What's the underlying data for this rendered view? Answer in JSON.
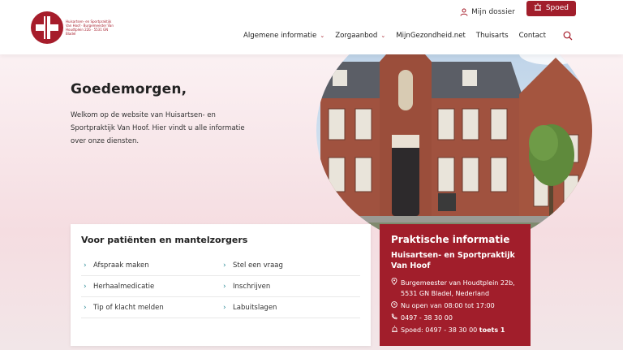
{
  "header": {
    "logo_text": "Huisartsen- en Sportpraktijk Van Hoof · Burgemeester Van Houdtplein 22b · 5531 GN Bladel",
    "dossier_label": "Mijn dossier",
    "spoed_label": "Spoed",
    "nav": [
      {
        "label": "Algemene informatie",
        "has_dropdown": true
      },
      {
        "label": "Zorgaanbod",
        "has_dropdown": true
      },
      {
        "label": "MijnGezondheid.net",
        "has_dropdown": false
      },
      {
        "label": "Thuisarts",
        "has_dropdown": false
      },
      {
        "label": "Contact",
        "has_dropdown": false
      }
    ]
  },
  "hero": {
    "greeting": "Goedemorgen,",
    "intro": "Welkom op de website van Huisartsen- en Sportpraktijk Van Hoof. Hier vindt u alle informatie over onze diensten."
  },
  "patients": {
    "title": "Voor patiënten en mantelzorgers",
    "links": [
      "Afspraak maken",
      "Stel een vraag",
      "Herhaalmedicatie",
      "Inschrijven",
      "Tip of klacht melden",
      "Labuitslagen"
    ]
  },
  "info": {
    "title": "Praktische informatie",
    "name": "Huisartsen- en Sportpraktijk Van Hoof",
    "address": "Burgemeester van Houdtplein 22b, 5531 GN Bladel, Nederland",
    "hours": "Nu open van 08:00 tot 17:00",
    "phone": "0497 - 38 30 00",
    "emergency_prefix": "Spoed: 0497 - 38 30 00 ",
    "emergency_suffix": "toets 1"
  },
  "colors": {
    "brand": "#a11e2b",
    "accent": "#2b8a96"
  }
}
